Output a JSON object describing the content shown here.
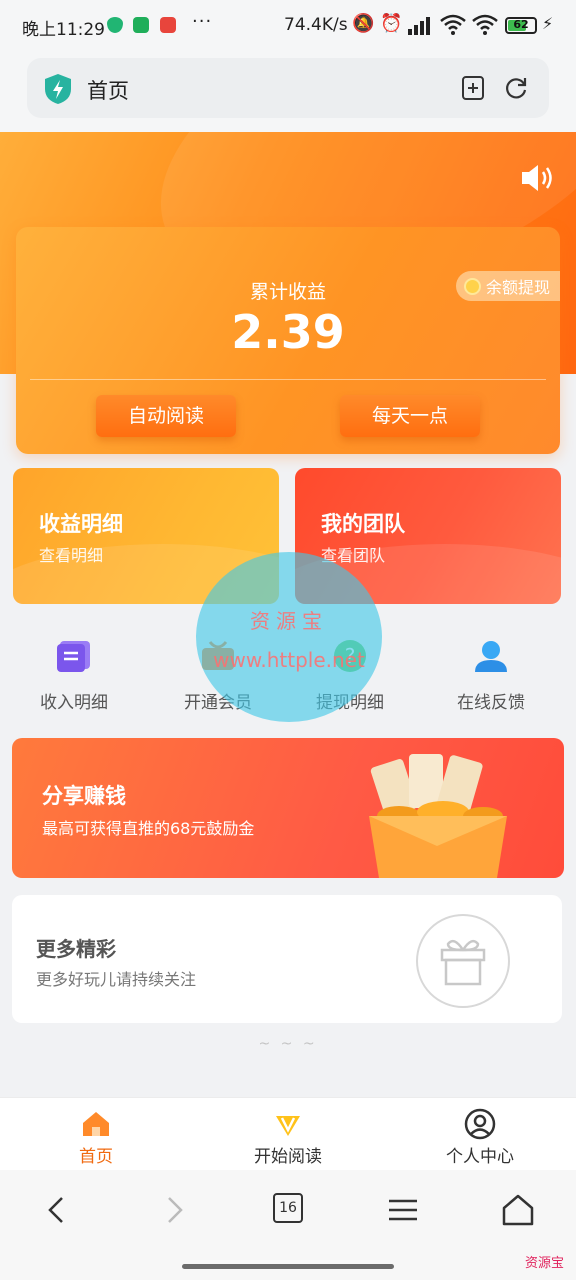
{
  "status_bar": {
    "time": "晚上11:29",
    "dots": "···",
    "net_speed": "74.4K/s",
    "battery": "62"
  },
  "address_bar": {
    "title": "首页"
  },
  "earnings": {
    "label": "累计收益",
    "value": "2.39",
    "withdraw_label": "余额提现",
    "auto_read_label": "自动阅读",
    "daily_label": "每天一点"
  },
  "tiles": [
    {
      "title": "收益明细",
      "subtitle": "查看明细"
    },
    {
      "title": "我的团队",
      "subtitle": "查看团队"
    }
  ],
  "shortcuts": [
    {
      "label": "收入明细",
      "icon": "document-icon"
    },
    {
      "label": "开通会员",
      "icon": "member-icon"
    },
    {
      "label": "提现明细",
      "icon": "question-icon"
    },
    {
      "label": "在线反馈",
      "icon": "user-icon"
    }
  ],
  "share_banner": {
    "title": "分享赚钱",
    "subtitle": "最高可获得直推的68元鼓励金"
  },
  "more_card": {
    "title": "更多精彩",
    "subtitle": "更多好玩儿请持续关注"
  },
  "divider_text": "~ ~ ~",
  "watermark": {
    "cn": "资源宝",
    "url": "www.httple.net",
    "corner": "资源宝"
  },
  "tab_bar": [
    {
      "label": "首页",
      "active": true
    },
    {
      "label": "开始阅读",
      "active": false
    },
    {
      "label": "个人中心",
      "active": false
    }
  ],
  "browser_nav": {
    "tab_count": "16"
  },
  "colors": {
    "orange": "#ff8a17",
    "red": "#ff5a45",
    "active_tab": "#f06a10",
    "watermark": "#40c8e6"
  }
}
